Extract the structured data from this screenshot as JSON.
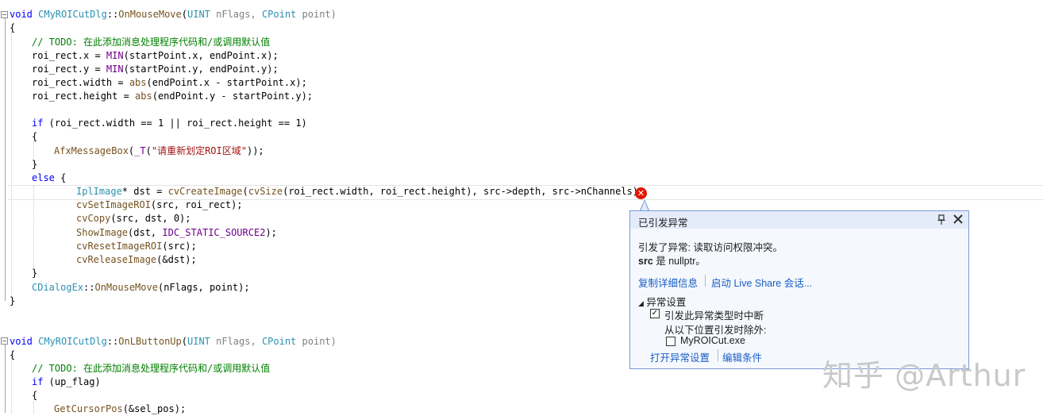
{
  "editor": {
    "block1": {
      "l1": [
        "void ",
        "CMyROICutDlg",
        "::",
        "OnMouseMove",
        "(",
        "UINT",
        " nFlags, ",
        "CPoint",
        " point)"
      ],
      "l2": "{",
      "l3": "// TODO: 在此添加消息处理程序代码和/或调用默认值",
      "l4": [
        "roi_rect.x = ",
        "MIN",
        "(startPoint.x, endPoint.x);"
      ],
      "l5": [
        "roi_rect.y = ",
        "MIN",
        "(startPoint.y, endPoint.y);"
      ],
      "l6": [
        "roi_rect.width = ",
        "abs",
        "(endPoint.x - startPoint.x);"
      ],
      "l7": [
        "roi_rect.height = ",
        "abs",
        "(endPoint.y - startPoint.y);"
      ],
      "l8": [
        "if",
        " (roi_rect.width == 1 || roi_rect.height == 1)"
      ],
      "l9": "{",
      "l10": [
        "AfxMessageBox",
        "(",
        "_T",
        "(",
        "\"请重新划定ROI区域\"",
        "));"
      ],
      "l11": "}",
      "l12": [
        "else",
        " {"
      ],
      "l13": [
        "IplImage",
        "* dst = ",
        "cvCreateImage",
        "(",
        "cvSize",
        "(roi_rect.width, roi_rect.height), src->depth, src->nChannels);"
      ],
      "l14": [
        "cvSetImageROI",
        "(src, roi_rect);"
      ],
      "l15": [
        "cvCopy",
        "(src, dst, 0);"
      ],
      "l16": [
        "ShowImage",
        "(dst, ",
        "IDC_STATIC_SOURCE2",
        ");"
      ],
      "l17": [
        "cvResetImageROI",
        "(src);"
      ],
      "l18": [
        "cvReleaseImage",
        "(&dst);"
      ],
      "l19": "}",
      "l20": [
        "CDialogEx",
        "::",
        "OnMouseMove",
        "(nFlags, point);"
      ],
      "l21": "}"
    },
    "block2": {
      "l1": [
        "void ",
        "CMyROICutDlg",
        "::",
        "OnLButtonUp",
        "(",
        "UINT",
        " nFlags, ",
        "CPoint",
        " point)"
      ],
      "l2": "{",
      "l3": "// TODO: 在此添加消息处理程序代码和/或调用默认值",
      "l4": [
        "if",
        " (up_flag)"
      ],
      "l5": "{",
      "l6": [
        "GetCursorPos",
        "(&sel_pos);"
      ]
    }
  },
  "exception_popup": {
    "title": "已引发异常",
    "message_line1": "引发了异常: 读取访问权限冲突。",
    "message_var": "src",
    "message_line2_rest": " 是 nullptr。",
    "link_copy_details": "复制详细信息",
    "link_live_share": "启动 Live Share 会话...",
    "settings_header": "异常设置",
    "break_when_thrown_label": "引发此异常类型时中断",
    "break_when_thrown_checked": true,
    "except_when_thrown_from_label": "从以下位置引发时除外:",
    "module_name": "MyROICut.exe",
    "module_checked": false,
    "link_open_settings": "打开异常设置",
    "link_edit_conditions": "编辑条件"
  },
  "icons": {
    "error": "error-circle-x-icon",
    "pin": "pin-icon",
    "close": "close-icon",
    "collapse": "collapse-triangle-icon"
  },
  "colors": {
    "keyword": "#0000ff",
    "type": "#2b91af",
    "comment": "#008000",
    "macro": "#6f008a",
    "string": "#a31515",
    "function": "#74531f",
    "error": "#e51400",
    "link": "#1a5ec7"
  },
  "watermark": "知乎 @Arthur"
}
